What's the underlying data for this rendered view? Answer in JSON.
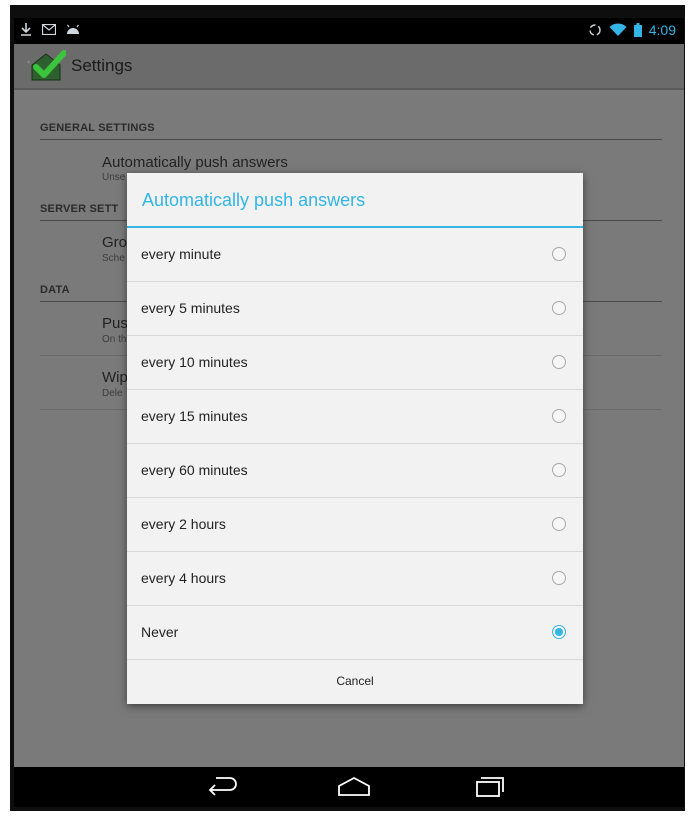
{
  "status_bar": {
    "left_icons": [
      "download-icon",
      "gmail-icon",
      "android-icon"
    ],
    "right_icons": [
      "sync-icon",
      "wifi-icon",
      "battery-icon"
    ],
    "time": "4:09"
  },
  "action_bar": {
    "title": "Settings"
  },
  "settings": {
    "sections": [
      {
        "header": "GENERAL SETTINGS",
        "items": [
          {
            "title": "Automatically push answers",
            "summary": "Unse"
          }
        ]
      },
      {
        "header": "SERVER SETT",
        "items": [
          {
            "title": "Grou",
            "summary": "Sche"
          }
        ]
      },
      {
        "header": "DATA",
        "items": [
          {
            "title": "Pus",
            "summary": "On th"
          },
          {
            "title": "Wip",
            "summary": "Dele"
          }
        ]
      }
    ]
  },
  "dialog": {
    "title": "Automatically push answers",
    "options": [
      {
        "label": "every minute",
        "checked": false
      },
      {
        "label": "every 5 minutes",
        "checked": false
      },
      {
        "label": "every 10 minutes",
        "checked": false
      },
      {
        "label": "every 15 minutes",
        "checked": false
      },
      {
        "label": "every 60 minutes",
        "checked": false
      },
      {
        "label": "every 2 hours",
        "checked": false
      },
      {
        "label": "every 4 hours",
        "checked": false
      },
      {
        "label": "Never",
        "checked": true
      }
    ],
    "cancel_label": "Cancel"
  },
  "nav_bar": {
    "buttons": [
      "back-icon",
      "home-icon",
      "recent-apps-icon"
    ]
  },
  "colors": {
    "accent": "#33b5e5"
  }
}
